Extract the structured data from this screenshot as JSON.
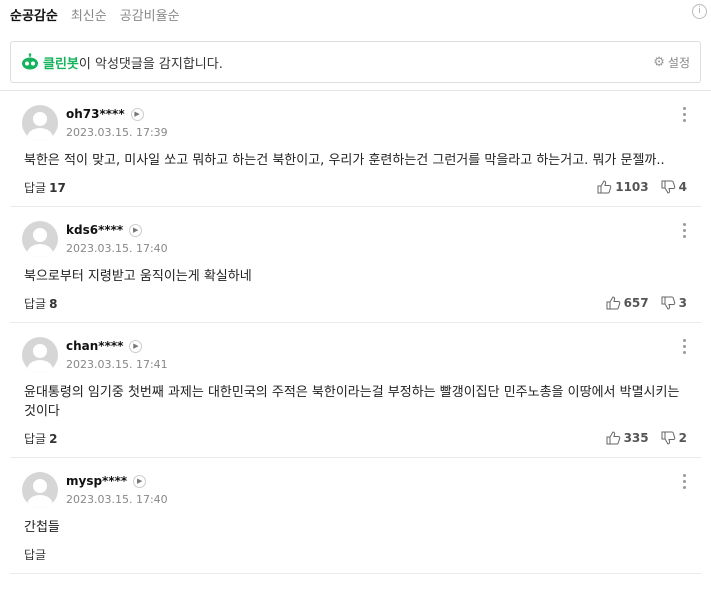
{
  "sort": {
    "tabs": [
      "순공감순",
      "최신순",
      "공감비율순"
    ],
    "active": 0,
    "info_icon": "i"
  },
  "cleanbot": {
    "name": "클린봇",
    "text": "이 악성댓글을 감지합니다.",
    "settings_label": "설정",
    "brand_color": "#16b35e"
  },
  "comments": [
    {
      "user": "oh73****",
      "date": "2023.03.15. 17:39",
      "text": "북한은 적이 맞고, 미사일 쏘고 뭐하고 하는건 북한이고, 우리가 훈련하는건 그런거를 막을라고 하는거고. 뭐가 문젤까..",
      "reply_label": "답글",
      "reply_count": "17",
      "likes": "1103",
      "dislikes": "4"
    },
    {
      "user": "kds6****",
      "date": "2023.03.15. 17:40",
      "text": "북으로부터 지령받고 움직이는게 확실하네",
      "reply_label": "답글",
      "reply_count": "8",
      "likes": "657",
      "dislikes": "3"
    },
    {
      "user": "chan****",
      "date": "2023.03.15. 17:41",
      "text": "윤대통령의 임기중 첫번째 과제는 대한민국의 주적은 북한이라는걸 부정하는 빨갱이집단 민주노총을 이땅에서 박멸시키는것이다",
      "reply_label": "답글",
      "reply_count": "2",
      "likes": "335",
      "dislikes": "2"
    },
    {
      "user": "mysp****",
      "date": "2023.03.15. 17:40",
      "text": "간첩들",
      "reply_label": "답글",
      "reply_count": "",
      "likes": "",
      "dislikes": ""
    }
  ]
}
